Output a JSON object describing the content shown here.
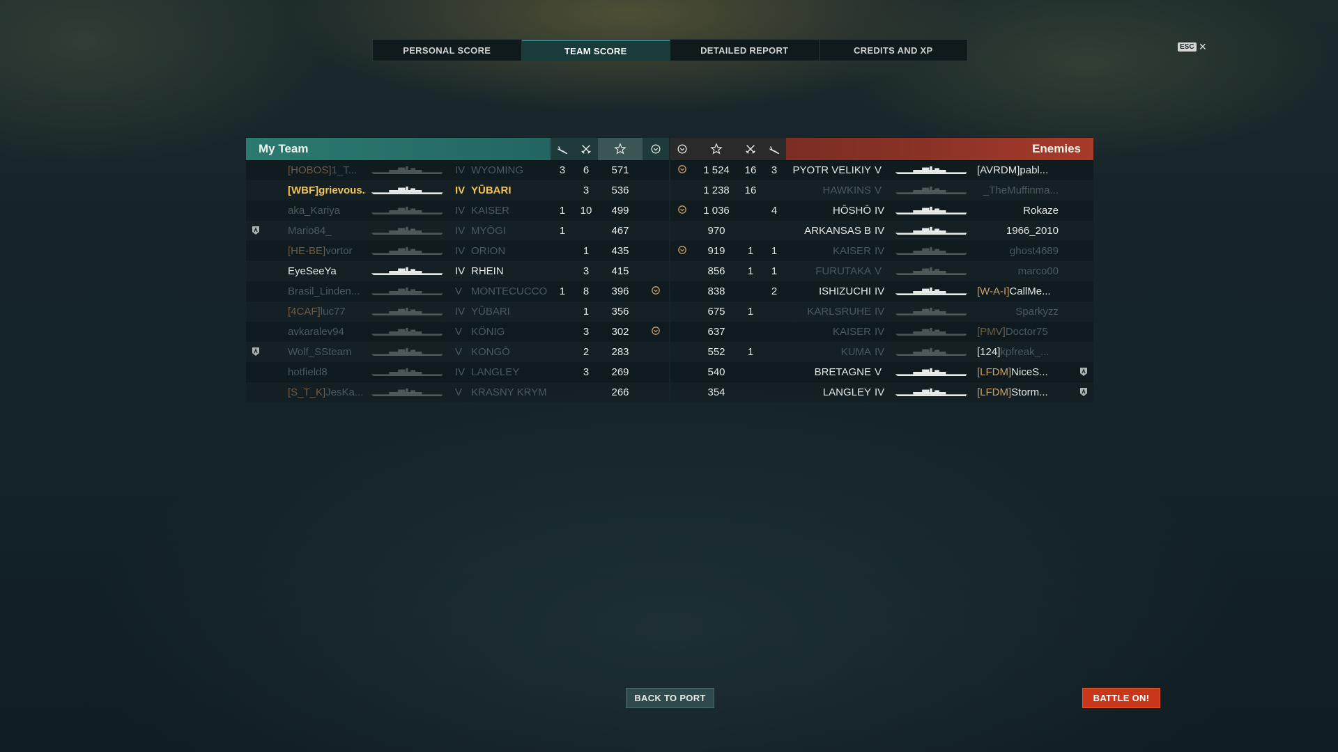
{
  "tabs": [
    {
      "label": "PERSONAL SCORE"
    },
    {
      "label": "TEAM SCORE"
    },
    {
      "label": "DETAILED REPORT"
    },
    {
      "label": "CREDITS AND XP"
    }
  ],
  "esc_label": "ESC",
  "my_team": {
    "title": "My Team",
    "rows": [
      {
        "clan": "[HOBOS]",
        "name": "1_T...",
        "tier": "IV",
        "ship": "WYOMING",
        "planes": "3",
        "kills": "6",
        "xp": "571",
        "base": false,
        "badge": false,
        "dim": true
      },
      {
        "clan": "[WBF]",
        "name": "grievous...",
        "tier": "IV",
        "ship": "YŪBARI",
        "planes": "",
        "kills": "3",
        "xp": "536",
        "base": false,
        "badge": false,
        "dim": false,
        "me": true
      },
      {
        "clan": "",
        "name": "aka_Kariya",
        "tier": "IV",
        "ship": "KAISER",
        "planes": "1",
        "kills": "10",
        "xp": "499",
        "base": false,
        "badge": false,
        "dim": true
      },
      {
        "clan": "",
        "name": "Mario84_",
        "tier": "IV",
        "ship": "MYŌGI",
        "planes": "1",
        "kills": "",
        "xp": "467",
        "base": false,
        "badge": true,
        "dim": true
      },
      {
        "clan": "[HE-BE]",
        "name": "vortor",
        "tier": "IV",
        "ship": "ORION",
        "planes": "",
        "kills": "1",
        "xp": "435",
        "base": false,
        "badge": false,
        "dim": true
      },
      {
        "clan": "",
        "name": "EyeSeeYa",
        "tier": "IV",
        "ship": "RHEIN",
        "planes": "",
        "kills": "3",
        "xp": "415",
        "base": false,
        "badge": false,
        "dim": false
      },
      {
        "clan": "",
        "name": "Brasil_Linden...",
        "tier": "V",
        "ship": "MONTECUCCOLI",
        "planes": "1",
        "kills": "8",
        "xp": "396",
        "base": true,
        "badge": false,
        "dim": true
      },
      {
        "clan": "[4CAF]",
        "name": "luc77",
        "tier": "IV",
        "ship": "YŪBARI",
        "planes": "",
        "kills": "1",
        "xp": "356",
        "base": false,
        "badge": false,
        "dim": true
      },
      {
        "clan": "",
        "name": "avkaralev94",
        "tier": "V",
        "ship": "KÖNIG",
        "planes": "",
        "kills": "3",
        "xp": "302",
        "base": true,
        "badge": false,
        "dim": true
      },
      {
        "clan": "",
        "name": "Wolf_SSteam",
        "tier": "V",
        "ship": "KONGŌ",
        "planes": "",
        "kills": "2",
        "xp": "283",
        "base": false,
        "badge": true,
        "dim": true
      },
      {
        "clan": "",
        "name": "hotfield8",
        "tier": "IV",
        "ship": "LANGLEY",
        "planes": "",
        "kills": "3",
        "xp": "269",
        "base": false,
        "badge": false,
        "dim": true
      },
      {
        "clan": "[S_T_K]",
        "name": "JesKa...",
        "tier": "V",
        "ship": "KRASNY KRYM",
        "planes": "",
        "kills": "",
        "xp": "266",
        "base": false,
        "badge": false,
        "dim": true
      }
    ]
  },
  "enemies": {
    "title": "Enemies",
    "rows": [
      {
        "base": true,
        "xp": "1 524",
        "kills": "16",
        "planes": "3",
        "ship": "PYOTR VELIKIY",
        "tier": "V",
        "clan": "[AVRDM]",
        "name": "pabl...",
        "badge": false,
        "dim": false,
        "clanplain": true
      },
      {
        "base": false,
        "xp": "1 238",
        "kills": "16",
        "planes": "",
        "ship": "HAWKINS",
        "tier": "V",
        "clan": "",
        "name": "_TheMuffinma...",
        "badge": false,
        "dim": true
      },
      {
        "base": true,
        "xp": "1 036",
        "kills": "",
        "planes": "4",
        "ship": "HŌSHŌ",
        "tier": "IV",
        "clan": "",
        "name": "Rokaze",
        "badge": false,
        "dim": false
      },
      {
        "base": false,
        "xp": "970",
        "kills": "",
        "planes": "",
        "ship": "ARKANSAS B",
        "tier": "IV",
        "clan": "",
        "name": "1966_2010",
        "badge": false,
        "dim": false
      },
      {
        "base": true,
        "xp": "919",
        "kills": "1",
        "planes": "1",
        "ship": "KAISER",
        "tier": "IV",
        "clan": "",
        "name": "ghost4689",
        "badge": false,
        "dim": true
      },
      {
        "base": false,
        "xp": "856",
        "kills": "1",
        "planes": "1",
        "ship": "FURUTAKA",
        "tier": "V",
        "clan": "",
        "name": "marco00",
        "badge": false,
        "dim": true
      },
      {
        "base": false,
        "xp": "838",
        "kills": "",
        "planes": "2",
        "ship": "ISHIZUCHI",
        "tier": "IV",
        "clan": "[W-A-I]",
        "name": "CallMe...",
        "badge": false,
        "dim": false
      },
      {
        "base": false,
        "xp": "675",
        "kills": "1",
        "planes": "",
        "ship": "KARLSRUHE",
        "tier": "IV",
        "clan": "",
        "name": "Sparkyzz",
        "badge": false,
        "dim": true
      },
      {
        "base": false,
        "xp": "637",
        "kills": "",
        "planes": "",
        "ship": "KAISER",
        "tier": "IV",
        "clan": "[PMV]",
        "name": "Doctor75",
        "badge": false,
        "dim": true
      },
      {
        "base": false,
        "xp": "552",
        "kills": "1",
        "planes": "",
        "ship": "KUMA",
        "tier": "IV",
        "clan": "[124]",
        "name": "kpfreak_...",
        "badge": false,
        "dim": true,
        "clanplain": true
      },
      {
        "base": false,
        "xp": "540",
        "kills": "",
        "planes": "",
        "ship": "BRETAGNE",
        "tier": "V",
        "clan": "[LFDM]",
        "name": "NiceS...",
        "badge": true,
        "dim": false
      },
      {
        "base": false,
        "xp": "354",
        "kills": "",
        "planes": "",
        "ship": "LANGLEY",
        "tier": "IV",
        "clan": "[LFDM]",
        "name": "Storm...",
        "badge": true,
        "dim": false
      }
    ]
  },
  "buttons": {
    "back_to_port": "BACK TO PORT",
    "battle_on": "BATTLE ON!"
  },
  "colors": {
    "my_team_header": "#2b7a70",
    "enemy_header": "#a83b2a",
    "player_highlight": "#f2c45a",
    "clan_tag": "#c9a06a",
    "battle_button": "#c9371a"
  }
}
